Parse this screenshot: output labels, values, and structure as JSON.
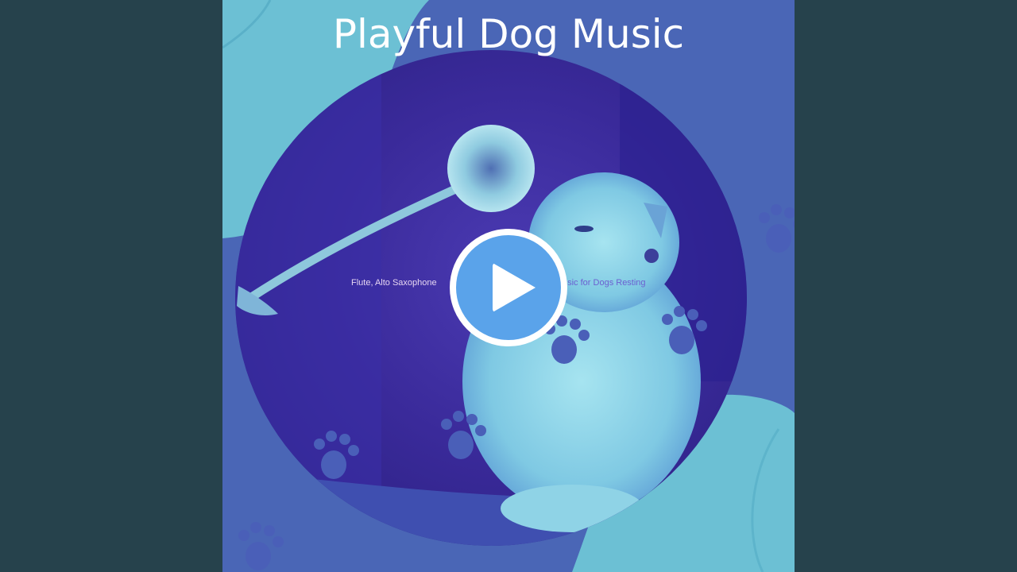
{
  "video": {
    "title": "Playful Dog Music",
    "subtitle_left": "Flute, Alto Saxophone",
    "subtitle_right": "usic for Dogs Resting"
  },
  "player": {
    "play_button_label": "Play",
    "play_icon": "play-triangle-icon",
    "accent_color": "#5aa3ea"
  },
  "colors": {
    "background": "#26424c",
    "artwork_blue": "#4a66b6",
    "artwork_cyan": "#6cc0d4",
    "photo_purple": "#3a2a9a"
  }
}
